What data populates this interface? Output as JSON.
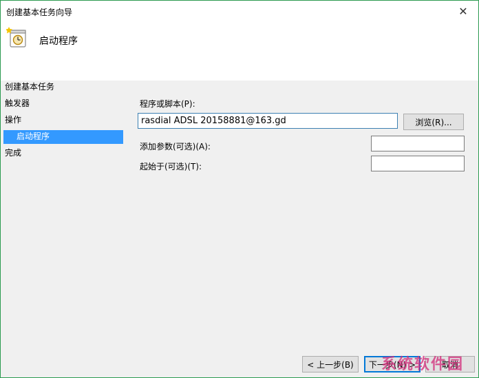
{
  "window": {
    "title": "创建基本任务向导",
    "close_glyph": "✕"
  },
  "header": {
    "title": "启动程序",
    "icon": "clock-task-icon"
  },
  "sidebar": {
    "items": [
      {
        "label": "创建基本任务",
        "selected": false
      },
      {
        "label": "触发器",
        "selected": false
      },
      {
        "label": "操作",
        "selected": false
      },
      {
        "label": "启动程序",
        "selected": true
      },
      {
        "label": "完成",
        "selected": false
      }
    ]
  },
  "form": {
    "program_label": "程序或脚本(P):",
    "program_value": "rasdial ADSL 20158881@163.gd",
    "browse_label": "浏览(R)...",
    "args_label": "添加参数(可选)(A):",
    "args_value": "",
    "startin_label": "起始于(可选)(T):",
    "startin_value": ""
  },
  "footer": {
    "back_label": "< 上一步(B)",
    "next_label": "下一步(N) >",
    "cancel_label": "取消"
  },
  "watermark": "系统软件园",
  "colors": {
    "selection": "#3399ff",
    "default_button_border": "#0078d7",
    "window_border": "#2b9a4f"
  }
}
